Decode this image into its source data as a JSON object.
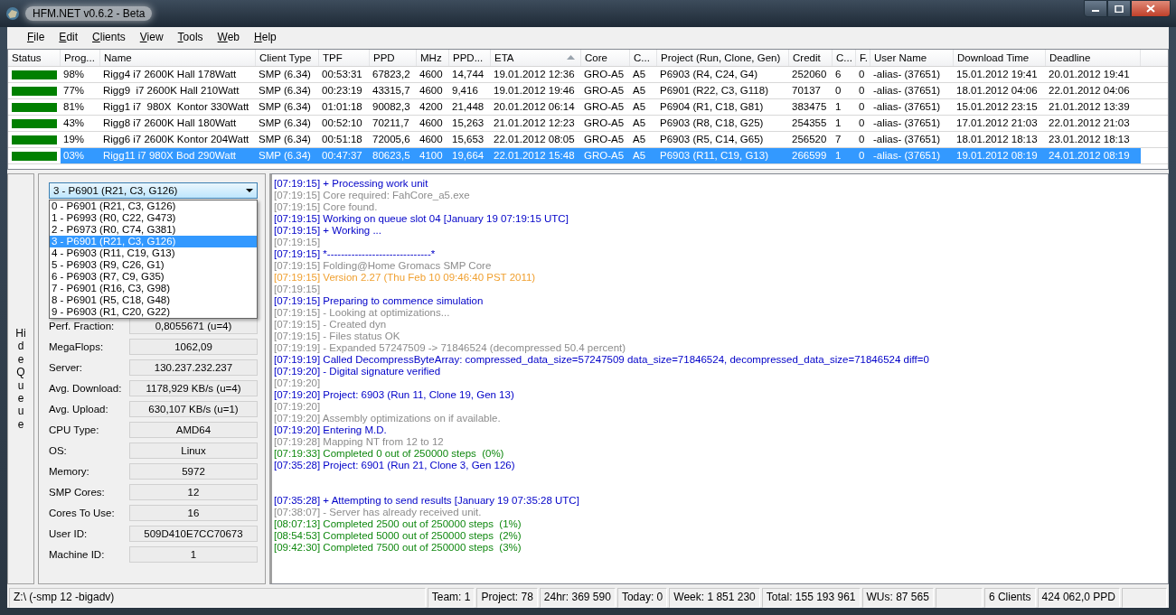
{
  "window": {
    "title": "HFM.NET v0.6.2 - Beta"
  },
  "menu": [
    "File",
    "Edit",
    "Clients",
    "View",
    "Tools",
    "Web",
    "Help"
  ],
  "table": {
    "columns": [
      {
        "label": "Status",
        "sorted": false
      },
      {
        "label": "Prog...",
        "sorted": false
      },
      {
        "label": "Name",
        "sorted": false
      },
      {
        "label": "Client Type",
        "sorted": false
      },
      {
        "label": "TPF",
        "sorted": false
      },
      {
        "label": "PPD",
        "sorted": false
      },
      {
        "label": "MHz",
        "sorted": false
      },
      {
        "label": "PPD...",
        "sorted": false
      },
      {
        "label": "ETA",
        "sorted": true
      },
      {
        "label": "Core",
        "sorted": false
      },
      {
        "label": "C...",
        "sorted": false
      },
      {
        "label": "Project (Run, Clone, Gen)",
        "sorted": false
      },
      {
        "label": "Credit",
        "sorted": false
      },
      {
        "label": "C...",
        "sorted": false
      },
      {
        "label": "F.",
        "sorted": false
      },
      {
        "label": "User Name",
        "sorted": false
      },
      {
        "label": "Download Time",
        "sorted": false
      },
      {
        "label": "Deadline",
        "sorted": false
      }
    ],
    "rows": [
      {
        "color": "#008000",
        "selected": false,
        "cells": [
          "",
          "98%",
          "Rigg4 i7 2600K Hall 178Watt",
          "SMP (6.34)",
          "00:53:31",
          "67823,2",
          "4600",
          "14,744",
          "19.01.2012 12:36",
          "GRO-A5",
          "A5",
          "P6903 (R4, C24, G4)",
          "252060",
          "6",
          "0",
          "-alias- (37651)",
          "15.01.2012 19:41",
          "20.01.2012 19:41"
        ]
      },
      {
        "color": "#008000",
        "selected": false,
        "cells": [
          "",
          "77%",
          "Rigg9  i7 2600K Hall 210Watt",
          "SMP (6.34)",
          "00:23:19",
          "43315,7",
          "4600",
          "9,416",
          "19.01.2012 19:46",
          "GRO-A5",
          "A5",
          "P6901 (R22, C3, G118)",
          "70137",
          "0",
          "0",
          "-alias- (37651)",
          "18.01.2012 04:06",
          "22.01.2012 04:06"
        ]
      },
      {
        "color": "#008000",
        "selected": false,
        "cells": [
          "",
          "81%",
          "Rigg1 i7  980X  Kontor 330Watt",
          "SMP (6.34)",
          "01:01:18",
          "90082,3",
          "4200",
          "21,448",
          "20.01.2012 06:14",
          "GRO-A5",
          "A5",
          "P6904 (R1, C18, G81)",
          "383475",
          "1",
          "0",
          "-alias- (37651)",
          "15.01.2012 23:15",
          "21.01.2012 13:39"
        ]
      },
      {
        "color": "#008000",
        "selected": false,
        "cells": [
          "",
          "43%",
          "Rigg8 i7 2600K Hall 180Watt",
          "SMP (6.34)",
          "00:52:10",
          "70211,7",
          "4600",
          "15,263",
          "21.01.2012 12:23",
          "GRO-A5",
          "A5",
          "P6903 (R8, C18, G25)",
          "254355",
          "1",
          "0",
          "-alias- (37651)",
          "17.01.2012 21:03",
          "22.01.2012 21:03"
        ]
      },
      {
        "color": "#008000",
        "selected": false,
        "cells": [
          "",
          "19%",
          "Rigg6 i7 2600K Kontor 204Watt",
          "SMP (6.34)",
          "00:51:18",
          "72005,6",
          "4600",
          "15,653",
          "22.01.2012 08:05",
          "GRO-A5",
          "A5",
          "P6903 (R5, C14, G65)",
          "256520",
          "7",
          "0",
          "-alias- (37651)",
          "18.01.2012 18:13",
          "23.01.2012 18:13"
        ]
      },
      {
        "color": "#008000",
        "selected": true,
        "cells": [
          "",
          "03%",
          "Rigg11 i7 980X Bod 290Watt",
          "SMP (6.34)",
          "00:47:37",
          "80623,5",
          "4100",
          "19,664",
          "22.01.2012 15:48",
          "GRO-A5",
          "A5",
          "P6903 (R11, C19, G13)",
          "266599",
          "1",
          "0",
          "-alias- (37651)",
          "19.01.2012 08:19",
          "24.01.2012 08:19"
        ]
      }
    ]
  },
  "queue_toggle": "Hide Queue",
  "queue": {
    "combo_value": "3 - P6901 (R21, C3, G126)",
    "expanded": true,
    "options": [
      {
        "label": "0 - P6901 (R21, C3, G126)",
        "selected": false
      },
      {
        "label": "1 - P6993 (R0, C22, G473)",
        "selected": false
      },
      {
        "label": "2 - P6973 (R0, C74, G381)",
        "selected": false
      },
      {
        "label": "3 - P6901 (R21, C3, G126)",
        "selected": true
      },
      {
        "label": "4 - P6903 (R11, C19, G13)",
        "selected": false
      },
      {
        "label": "5 - P6903 (R9, C26, G1)",
        "selected": false
      },
      {
        "label": "6 - P6903 (R7, C9, G35)",
        "selected": false
      },
      {
        "label": "7 - P6901 (R16, C3, G98)",
        "selected": false
      },
      {
        "label": "8 - P6901 (R5, C18, G48)",
        "selected": false
      },
      {
        "label": "9 - P6903 (R1, C20, G22)",
        "selected": false
      }
    ],
    "fields": [
      {
        "label": "Perf. Fraction:",
        "value": "0,8055671 (u=4)"
      },
      {
        "label": "MegaFlops:",
        "value": "1062,09"
      },
      {
        "label": "Server:",
        "value": "130.237.232.237"
      },
      {
        "label": "Avg. Download:",
        "value": "1178,929 KB/s (u=4)"
      },
      {
        "label": "Avg. Upload:",
        "value": "630,107 KB/s (u=1)"
      },
      {
        "label": "CPU Type:",
        "value": "AMD64"
      },
      {
        "label": "OS:",
        "value": "Linux"
      },
      {
        "label": "Memory:",
        "value": "5972"
      },
      {
        "label": "SMP Cores:",
        "value": "12"
      },
      {
        "label": "Cores To Use:",
        "value": "16"
      },
      {
        "label": "User ID:",
        "value": "509D410E7CC70673"
      },
      {
        "label": "Machine ID:",
        "value": "1"
      }
    ]
  },
  "log": [
    {
      "kind": "info",
      "text": "[07:19:15] + Processing work unit"
    },
    {
      "kind": "plain",
      "text": "[07:19:15] Core required: FahCore_a5.exe"
    },
    {
      "kind": "plain",
      "text": "[07:19:15] Core found."
    },
    {
      "kind": "info",
      "text": "[07:19:15] Working on queue slot 04 [January 19 07:19:15 UTC]"
    },
    {
      "kind": "info",
      "text": "[07:19:15] + Working ..."
    },
    {
      "kind": "plain",
      "text": "[07:19:15]"
    },
    {
      "kind": "info",
      "text": "[07:19:15] *------------------------------*"
    },
    {
      "kind": "plain",
      "text": "[07:19:15] Folding@Home Gromacs SMP Core"
    },
    {
      "kind": "warn",
      "text": "[07:19:15] Version 2.27 (Thu Feb 10 09:46:40 PST 2011)"
    },
    {
      "kind": "plain",
      "text": "[07:19:15]"
    },
    {
      "kind": "info",
      "text": "[07:19:15] Preparing to commence simulation"
    },
    {
      "kind": "plain",
      "text": "[07:19:15] - Looking at optimizations..."
    },
    {
      "kind": "plain",
      "text": "[07:19:15] - Created dyn"
    },
    {
      "kind": "plain",
      "text": "[07:19:15] - Files status OK"
    },
    {
      "kind": "plain",
      "text": "[07:19:19] - Expanded 57247509 -> 71846524 (decompressed 50.4 percent)"
    },
    {
      "kind": "info",
      "text": "[07:19:19] Called DecompressByteArray: compressed_data_size=57247509 data_size=71846524, decompressed_data_size=71846524 diff=0"
    },
    {
      "kind": "info",
      "text": "[07:19:20] - Digital signature verified"
    },
    {
      "kind": "plain",
      "text": "[07:19:20]"
    },
    {
      "kind": "info",
      "text": "[07:19:20] Project: 6903 (Run 11, Clone 19, Gen 13)"
    },
    {
      "kind": "plain",
      "text": "[07:19:20]"
    },
    {
      "kind": "plain",
      "text": "[07:19:20] Assembly optimizations on if available."
    },
    {
      "kind": "info",
      "text": "[07:19:20] Entering M.D."
    },
    {
      "kind": "plain",
      "text": "[07:19:28] Mapping NT from 12 to 12"
    },
    {
      "kind": "ok",
      "text": "[07:19:33] Completed 0 out of 250000 steps  (0%)"
    },
    {
      "kind": "info",
      "text": "[07:35:28] Project: 6901 (Run 21, Clone 3, Gen 126)"
    },
    {
      "kind": "blank"
    },
    {
      "kind": "blank"
    },
    {
      "kind": "info",
      "text": "[07:35:28] + Attempting to send results [January 19 07:35:28 UTC]"
    },
    {
      "kind": "plain",
      "text": "[07:38:07] - Server has already received unit."
    },
    {
      "kind": "ok",
      "text": "[08:07:13] Completed 2500 out of 250000 steps  (1%)"
    },
    {
      "kind": "ok",
      "text": "[08:54:53] Completed 5000 out of 250000 steps  (2%)"
    },
    {
      "kind": "ok",
      "text": "[09:42:30] Completed 7500 out of 250000 steps  (3%)"
    }
  ],
  "status_bar": [
    "Z:\\ (-smp 12 -bigadv)",
    "Team: 1",
    "Project: 78",
    "24hr: 369 590",
    "Today: 0",
    "Week: 1 851 230",
    "Total: 155 193 961",
    "WUs: 87 565",
    "6 Clients",
    "424 062,0 PPD"
  ]
}
